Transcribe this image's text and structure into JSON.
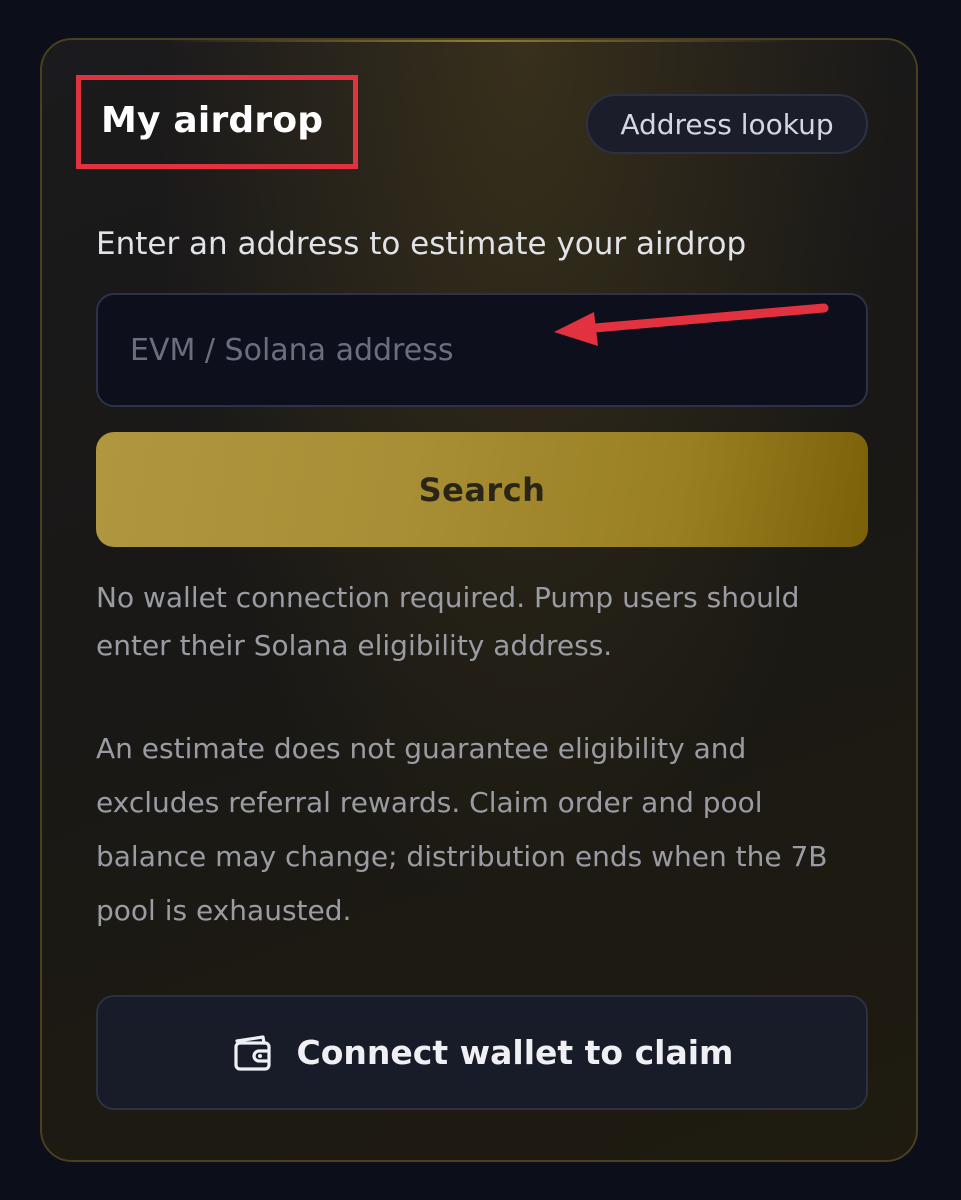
{
  "card": {
    "title": "My airdrop",
    "lookup_button": "Address lookup",
    "prompt": "Enter an address to estimate your airdrop",
    "address_input": {
      "value": "",
      "placeholder": "EVM / Solana address"
    },
    "search_button": "Search",
    "note_wallet": "No wallet connection required. Pump users should enter their Solana eligibility address.",
    "note_estimate": "An estimate does not guarantee eligibility and excludes referral rewards. Claim order and pool balance may change; distribution ends when the 7B pool is exhausted.",
    "connect_button": {
      "label": "Connect wallet to claim",
      "icon": "wallet-icon"
    }
  },
  "colors": {
    "background": "#0c0e1a",
    "accent_gold": "#a88e35",
    "highlight_red": "#e2313f"
  }
}
